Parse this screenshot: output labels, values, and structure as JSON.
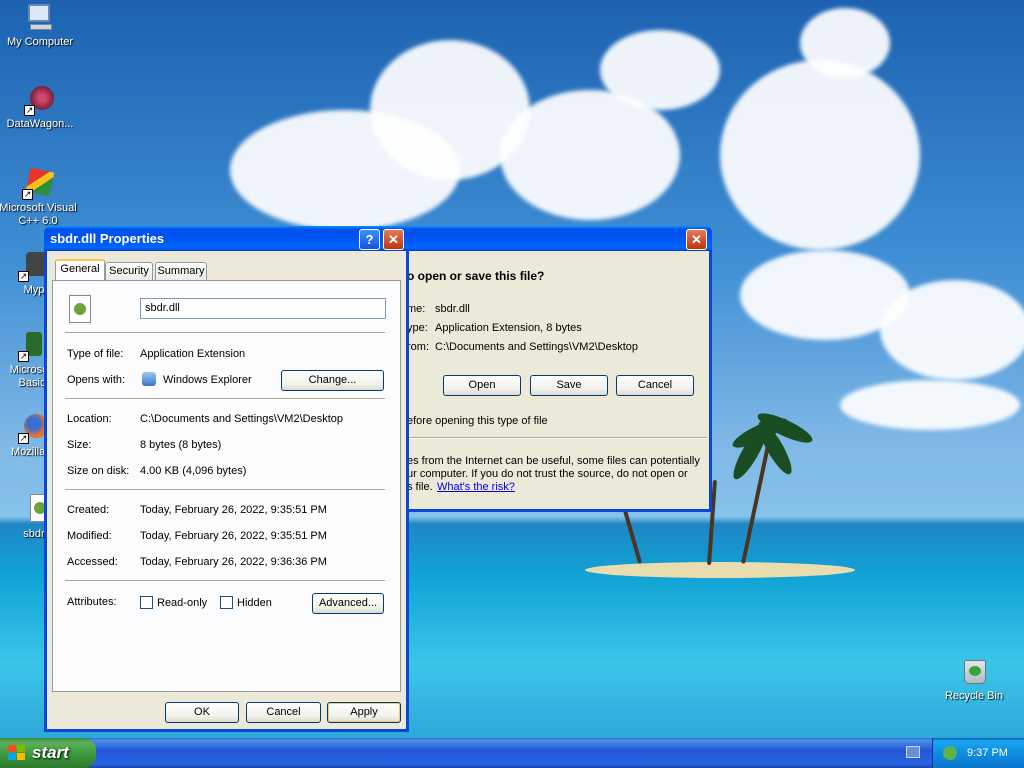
{
  "desktop": {
    "icons": [
      {
        "label": "My Computer"
      },
      {
        "label": "DataWagon..."
      },
      {
        "label": "Microsoft Visual C++ 6.0"
      },
      {
        "label": "Myp"
      },
      {
        "label": "Microsoft Basic"
      },
      {
        "label": "Mozilla F"
      },
      {
        "label": "sbdr"
      },
      {
        "label": "Recycle Bin"
      }
    ]
  },
  "download_dialog": {
    "question": "o open or save this file?",
    "name_label": "me:",
    "name_value": "sbdr.dll",
    "type_label": "ype:",
    "type_value": "Application Extension, 8 bytes",
    "from_label": "rom:",
    "from_value": "C:\\Documents and Settings\\VM2\\Desktop",
    "open_button": "Open",
    "save_button": "Save",
    "cancel_button": "Cancel",
    "always_ask": "efore opening this type of file",
    "warning_line1": "es from the Internet can be useful, some files can potentially",
    "warning_line2": "ur computer. If you do not trust the source, do not open or",
    "warning_line3": "s file.",
    "risk_link": "What's the risk?"
  },
  "properties": {
    "title": "sbdr.dll Properties",
    "tabs": [
      "General",
      "Security",
      "Summary"
    ],
    "file_name": "sbdr.dll",
    "type_label": "Type of file:",
    "type_value": "Application Extension",
    "opens_label": "Opens with:",
    "opens_value": "Windows Explorer",
    "change_button": "Change...",
    "location_label": "Location:",
    "location_value": "C:\\Documents and Settings\\VM2\\Desktop",
    "size_label": "Size:",
    "size_value": "8 bytes (8 bytes)",
    "size_on_disk_label": "Size on disk:",
    "size_on_disk_value": "4.00 KB (4,096 bytes)",
    "created_label": "Created:",
    "created_value": "Today, February 26, 2022, 9:35:51 PM",
    "modified_label": "Modified:",
    "modified_value": "Today, February 26, 2022, 9:35:51 PM",
    "accessed_label": "Accessed:",
    "accessed_value": "Today, February 26, 2022, 9:36:36 PM",
    "attributes_label": "Attributes:",
    "readonly_label": "Read-only",
    "hidden_label": "Hidden",
    "advanced_button": "Advanced...",
    "ok_button": "OK",
    "cancel_button": "Cancel",
    "apply_button": "Apply",
    "help_glyph": "?",
    "close_glyph": "✕"
  },
  "taskbar": {
    "start_label": "start",
    "clock": "9:37 PM"
  },
  "colors": {
    "titlebar": "#0050ee",
    "dialog_bg": "#ece9d8",
    "start_green": "#389638",
    "taskbar_blue": "#2157d7"
  }
}
